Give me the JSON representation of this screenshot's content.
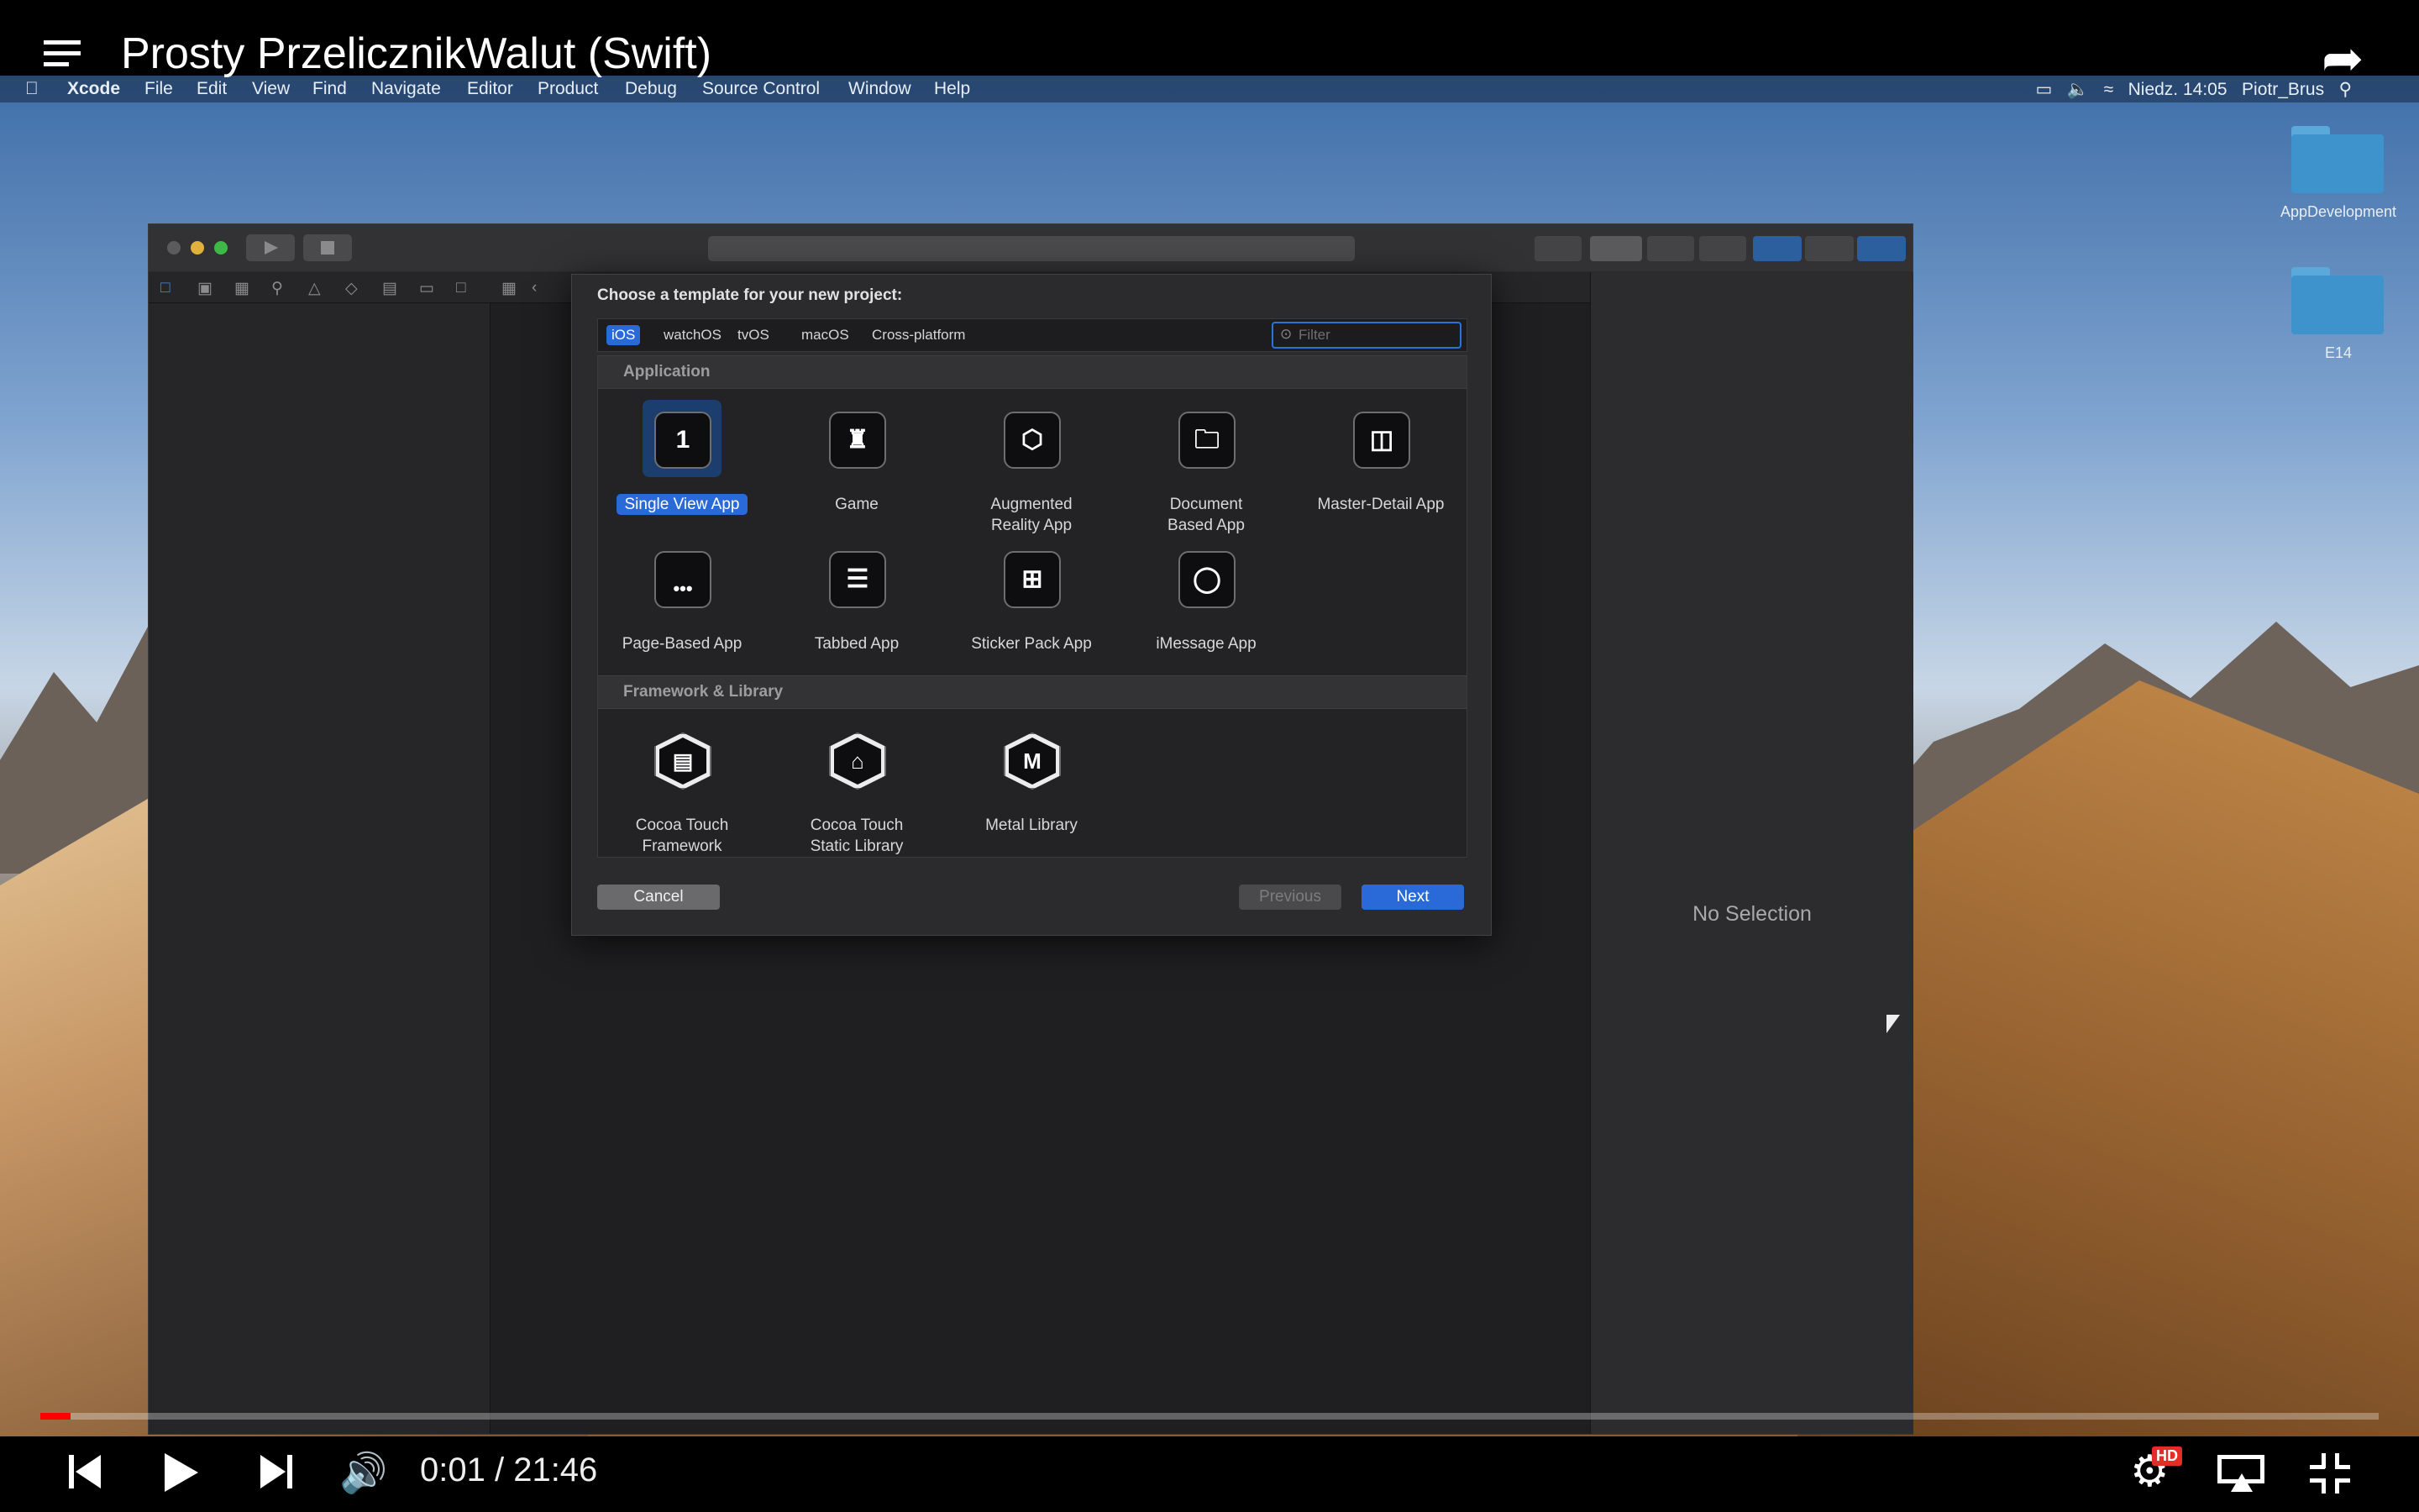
{
  "video": {
    "title": "Prosty PrzelicznikWalut (Swift)",
    "current_time": "0:01",
    "duration": "21:46",
    "time_separator": " / ",
    "progress_fraction": 0.013,
    "hd_badge": "HD"
  },
  "menubar": {
    "app": "Xcode",
    "items": [
      "File",
      "Edit",
      "View",
      "Find",
      "Navigate",
      "Editor",
      "Product",
      "Debug",
      "Source Control",
      "Window",
      "Help"
    ],
    "clock": "Niedz. 14:05",
    "user": "Piotr_Brus"
  },
  "desktop": {
    "folders": [
      "AppDevelopment",
      "E14"
    ]
  },
  "xcode": {
    "inspector_empty": "No Selection"
  },
  "dialog": {
    "title": "Choose a template for your new project:",
    "platform_tabs": [
      "iOS",
      "watchOS",
      "tvOS",
      "macOS",
      "Cross-platform"
    ],
    "selected_tab": "iOS",
    "filter_placeholder": "Filter",
    "sections": [
      {
        "name": "Application",
        "templates": [
          {
            "label": "Single View App",
            "icon": "single-view-icon",
            "selected": true
          },
          {
            "label": "Game",
            "icon": "game-icon"
          },
          {
            "label": "Augmented\nReality App",
            "icon": "ar-cube-icon"
          },
          {
            "label": "Document\nBased App",
            "icon": "folder-icon"
          },
          {
            "label": "Master-Detail App",
            "icon": "master-detail-icon"
          },
          {
            "label": "Page-Based App",
            "icon": "page-dots-icon"
          },
          {
            "label": "Tabbed App",
            "icon": "tabbed-icon"
          },
          {
            "label": "Sticker Pack App",
            "icon": "sticker-grid-icon"
          },
          {
            "label": "iMessage App",
            "icon": "speech-bubble-icon"
          }
        ]
      },
      {
        "name": "Framework & Library",
        "templates": [
          {
            "label": "Cocoa Touch\nFramework",
            "icon": "briefcase-icon"
          },
          {
            "label": "Cocoa Touch\nStatic Library",
            "icon": "library-icon"
          },
          {
            "label": "Metal Library",
            "icon": "metal-icon"
          }
        ]
      }
    ],
    "buttons": {
      "cancel": "Cancel",
      "previous": "Previous",
      "next": "Next"
    }
  },
  "colors": {
    "selection_blue": "#2a6ad8",
    "progress_red": "#ff0000"
  }
}
